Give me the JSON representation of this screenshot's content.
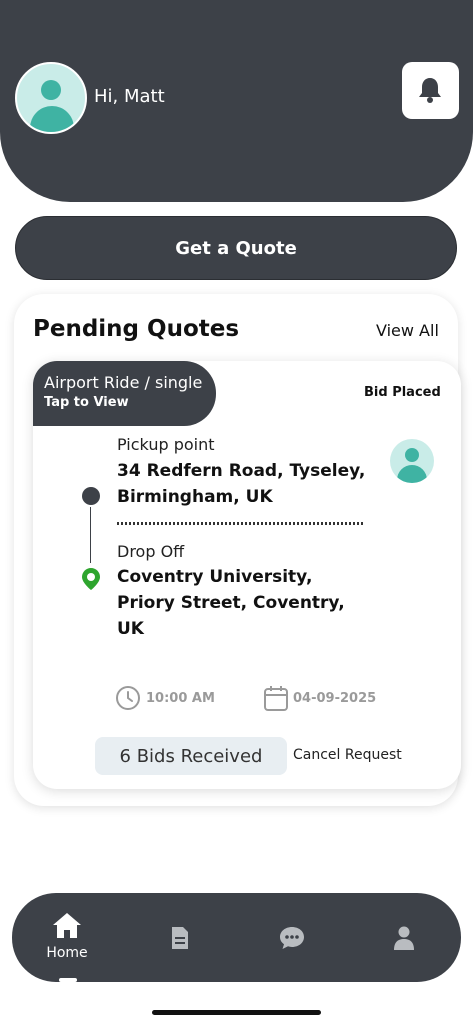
{
  "header": {
    "greeting": "Hi, Matt",
    "avatar_icon": "user-avatar-icon",
    "notification_icon": "bell-icon"
  },
  "actions": {
    "get_quote_label": "Get a Quote"
  },
  "pending": {
    "title": "Pending Quotes",
    "view_all": "View All",
    "quote": {
      "ride_type": "Airport Ride / single",
      "tap_hint": "Tap to View",
      "status": "Bid Placed",
      "pickup_label": "Pickup point",
      "pickup_address": "34 Redfern Road, Tyseley, Birmingham, UK",
      "dropoff_label": "Drop Off",
      "dropoff_address": "Coventry University, Priory Street, Coventry, UK",
      "time": "10:00 AM",
      "date": "04-09-2025",
      "bids_received": "6 Bids Received",
      "cancel_label": "Cancel Request"
    }
  },
  "tabbar": {
    "items": [
      {
        "label": "Home",
        "icon": "home-icon",
        "active": true
      },
      {
        "label": "",
        "icon": "document-icon",
        "active": false
      },
      {
        "label": "",
        "icon": "chat-icon",
        "active": false
      },
      {
        "label": "",
        "icon": "profile-icon",
        "active": false
      }
    ]
  },
  "colors": {
    "primary_dark": "#3d4148",
    "accent_teal": "#3fb3a3",
    "pin_green": "#2ea52e",
    "muted_gray": "#9a9a9a"
  }
}
